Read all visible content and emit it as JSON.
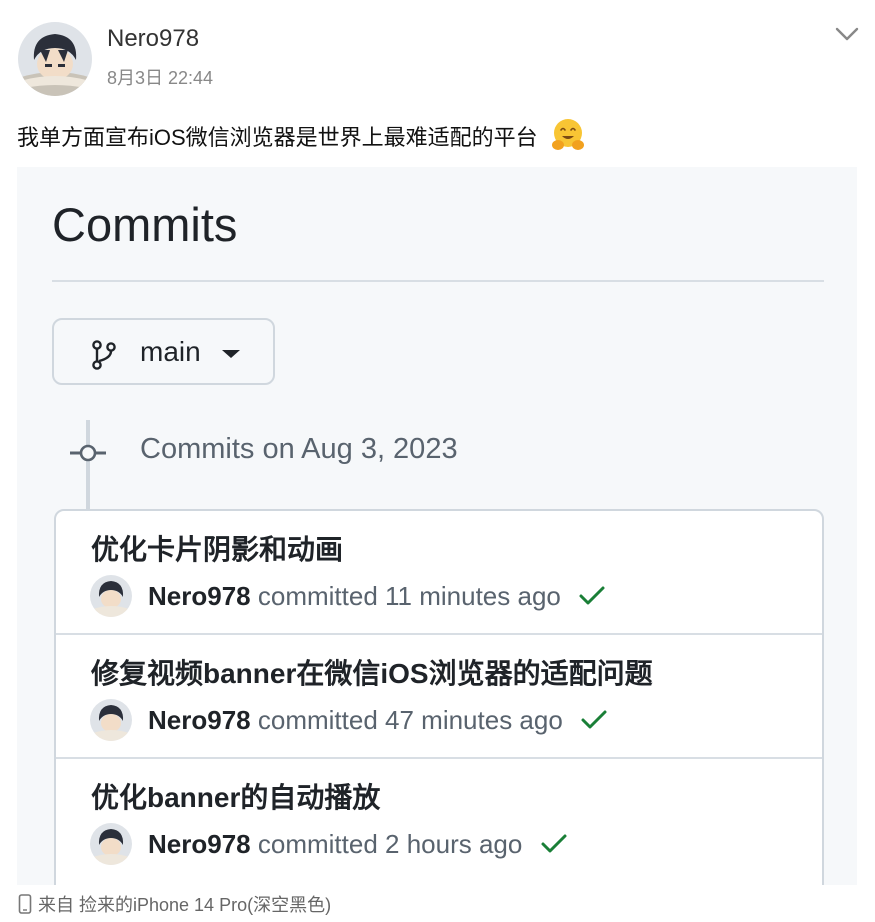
{
  "post": {
    "author": "Nero978",
    "time": "8月3日 22:44",
    "text": "我单方面宣布iOS微信浏览器是世界上最难适配的平台",
    "emoji": "hugging-face-emoji"
  },
  "screenshot": {
    "title": "Commits",
    "branch": "main",
    "group_heading": "Commits on Aug 3, 2023",
    "commits": [
      {
        "title": "优化卡片阴影和动画",
        "author": "Nero978",
        "action": "committed",
        "time": "11 minutes ago"
      },
      {
        "title": "修复视频banner在微信iOS浏览器的适配问题",
        "author": "Nero978",
        "action": "committed",
        "time": "47 minutes ago"
      },
      {
        "title": "优化banner的自动播放",
        "author": "Nero978",
        "action": "committed",
        "time": "2 hours ago"
      }
    ]
  },
  "footer": {
    "source": "来自 捡来的iPhone 14 Pro(深空黑色)"
  },
  "colors": {
    "success_check": "#1a7f37",
    "muted_text": "#59636e",
    "border": "#d0d7de"
  }
}
